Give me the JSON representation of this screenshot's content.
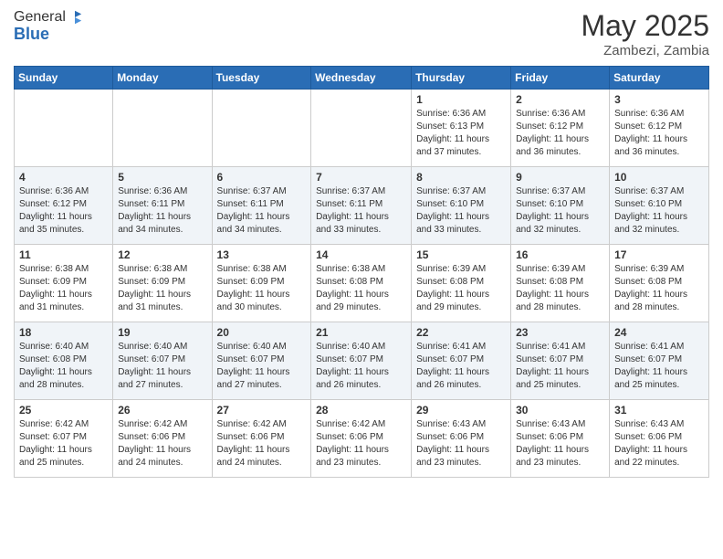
{
  "header": {
    "logo_general": "General",
    "logo_blue": "Blue",
    "month": "May 2025",
    "location": "Zambezi, Zambia"
  },
  "days_of_week": [
    "Sunday",
    "Monday",
    "Tuesday",
    "Wednesday",
    "Thursday",
    "Friday",
    "Saturday"
  ],
  "weeks": [
    [
      {
        "day": "",
        "sunrise": "",
        "sunset": "",
        "daylight": ""
      },
      {
        "day": "",
        "sunrise": "",
        "sunset": "",
        "daylight": ""
      },
      {
        "day": "",
        "sunrise": "",
        "sunset": "",
        "daylight": ""
      },
      {
        "day": "",
        "sunrise": "",
        "sunset": "",
        "daylight": ""
      },
      {
        "day": "1",
        "sunrise": "Sunrise: 6:36 AM",
        "sunset": "Sunset: 6:13 PM",
        "daylight": "Daylight: 11 hours and 37 minutes."
      },
      {
        "day": "2",
        "sunrise": "Sunrise: 6:36 AM",
        "sunset": "Sunset: 6:12 PM",
        "daylight": "Daylight: 11 hours and 36 minutes."
      },
      {
        "day": "3",
        "sunrise": "Sunrise: 6:36 AM",
        "sunset": "Sunset: 6:12 PM",
        "daylight": "Daylight: 11 hours and 36 minutes."
      }
    ],
    [
      {
        "day": "4",
        "sunrise": "Sunrise: 6:36 AM",
        "sunset": "Sunset: 6:12 PM",
        "daylight": "Daylight: 11 hours and 35 minutes."
      },
      {
        "day": "5",
        "sunrise": "Sunrise: 6:36 AM",
        "sunset": "Sunset: 6:11 PM",
        "daylight": "Daylight: 11 hours and 34 minutes."
      },
      {
        "day": "6",
        "sunrise": "Sunrise: 6:37 AM",
        "sunset": "Sunset: 6:11 PM",
        "daylight": "Daylight: 11 hours and 34 minutes."
      },
      {
        "day": "7",
        "sunrise": "Sunrise: 6:37 AM",
        "sunset": "Sunset: 6:11 PM",
        "daylight": "Daylight: 11 hours and 33 minutes."
      },
      {
        "day": "8",
        "sunrise": "Sunrise: 6:37 AM",
        "sunset": "Sunset: 6:10 PM",
        "daylight": "Daylight: 11 hours and 33 minutes."
      },
      {
        "day": "9",
        "sunrise": "Sunrise: 6:37 AM",
        "sunset": "Sunset: 6:10 PM",
        "daylight": "Daylight: 11 hours and 32 minutes."
      },
      {
        "day": "10",
        "sunrise": "Sunrise: 6:37 AM",
        "sunset": "Sunset: 6:10 PM",
        "daylight": "Daylight: 11 hours and 32 minutes."
      }
    ],
    [
      {
        "day": "11",
        "sunrise": "Sunrise: 6:38 AM",
        "sunset": "Sunset: 6:09 PM",
        "daylight": "Daylight: 11 hours and 31 minutes."
      },
      {
        "day": "12",
        "sunrise": "Sunrise: 6:38 AM",
        "sunset": "Sunset: 6:09 PM",
        "daylight": "Daylight: 11 hours and 31 minutes."
      },
      {
        "day": "13",
        "sunrise": "Sunrise: 6:38 AM",
        "sunset": "Sunset: 6:09 PM",
        "daylight": "Daylight: 11 hours and 30 minutes."
      },
      {
        "day": "14",
        "sunrise": "Sunrise: 6:38 AM",
        "sunset": "Sunset: 6:08 PM",
        "daylight": "Daylight: 11 hours and 29 minutes."
      },
      {
        "day": "15",
        "sunrise": "Sunrise: 6:39 AM",
        "sunset": "Sunset: 6:08 PM",
        "daylight": "Daylight: 11 hours and 29 minutes."
      },
      {
        "day": "16",
        "sunrise": "Sunrise: 6:39 AM",
        "sunset": "Sunset: 6:08 PM",
        "daylight": "Daylight: 11 hours and 28 minutes."
      },
      {
        "day": "17",
        "sunrise": "Sunrise: 6:39 AM",
        "sunset": "Sunset: 6:08 PM",
        "daylight": "Daylight: 11 hours and 28 minutes."
      }
    ],
    [
      {
        "day": "18",
        "sunrise": "Sunrise: 6:40 AM",
        "sunset": "Sunset: 6:08 PM",
        "daylight": "Daylight: 11 hours and 28 minutes."
      },
      {
        "day": "19",
        "sunrise": "Sunrise: 6:40 AM",
        "sunset": "Sunset: 6:07 PM",
        "daylight": "Daylight: 11 hours and 27 minutes."
      },
      {
        "day": "20",
        "sunrise": "Sunrise: 6:40 AM",
        "sunset": "Sunset: 6:07 PM",
        "daylight": "Daylight: 11 hours and 27 minutes."
      },
      {
        "day": "21",
        "sunrise": "Sunrise: 6:40 AM",
        "sunset": "Sunset: 6:07 PM",
        "daylight": "Daylight: 11 hours and 26 minutes."
      },
      {
        "day": "22",
        "sunrise": "Sunrise: 6:41 AM",
        "sunset": "Sunset: 6:07 PM",
        "daylight": "Daylight: 11 hours and 26 minutes."
      },
      {
        "day": "23",
        "sunrise": "Sunrise: 6:41 AM",
        "sunset": "Sunset: 6:07 PM",
        "daylight": "Daylight: 11 hours and 25 minutes."
      },
      {
        "day": "24",
        "sunrise": "Sunrise: 6:41 AM",
        "sunset": "Sunset: 6:07 PM",
        "daylight": "Daylight: 11 hours and 25 minutes."
      }
    ],
    [
      {
        "day": "25",
        "sunrise": "Sunrise: 6:42 AM",
        "sunset": "Sunset: 6:07 PM",
        "daylight": "Daylight: 11 hours and 25 minutes."
      },
      {
        "day": "26",
        "sunrise": "Sunrise: 6:42 AM",
        "sunset": "Sunset: 6:06 PM",
        "daylight": "Daylight: 11 hours and 24 minutes."
      },
      {
        "day": "27",
        "sunrise": "Sunrise: 6:42 AM",
        "sunset": "Sunset: 6:06 PM",
        "daylight": "Daylight: 11 hours and 24 minutes."
      },
      {
        "day": "28",
        "sunrise": "Sunrise: 6:42 AM",
        "sunset": "Sunset: 6:06 PM",
        "daylight": "Daylight: 11 hours and 23 minutes."
      },
      {
        "day": "29",
        "sunrise": "Sunrise: 6:43 AM",
        "sunset": "Sunset: 6:06 PM",
        "daylight": "Daylight: 11 hours and 23 minutes."
      },
      {
        "day": "30",
        "sunrise": "Sunrise: 6:43 AM",
        "sunset": "Sunset: 6:06 PM",
        "daylight": "Daylight: 11 hours and 23 minutes."
      },
      {
        "day": "31",
        "sunrise": "Sunrise: 6:43 AM",
        "sunset": "Sunset: 6:06 PM",
        "daylight": "Daylight: 11 hours and 22 minutes."
      }
    ]
  ]
}
